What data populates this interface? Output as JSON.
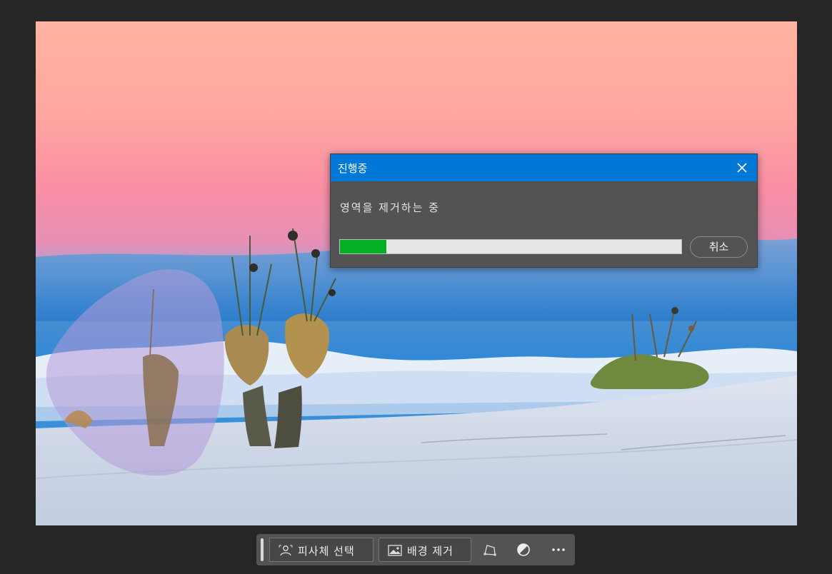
{
  "dialog": {
    "title": "진행중",
    "message": "영역을 제거하는 중",
    "progress": 0.135,
    "cancel_label": "취소",
    "accent_color": "#0078d7",
    "progress_color": "#06b025"
  },
  "taskbar": {
    "select_subject_label": "피사체 선택",
    "remove_background_label": "배경 제거",
    "icons": [
      "person-select-icon",
      "image-icon",
      "transform-icon",
      "adjustment-icon",
      "more-icon"
    ]
  }
}
